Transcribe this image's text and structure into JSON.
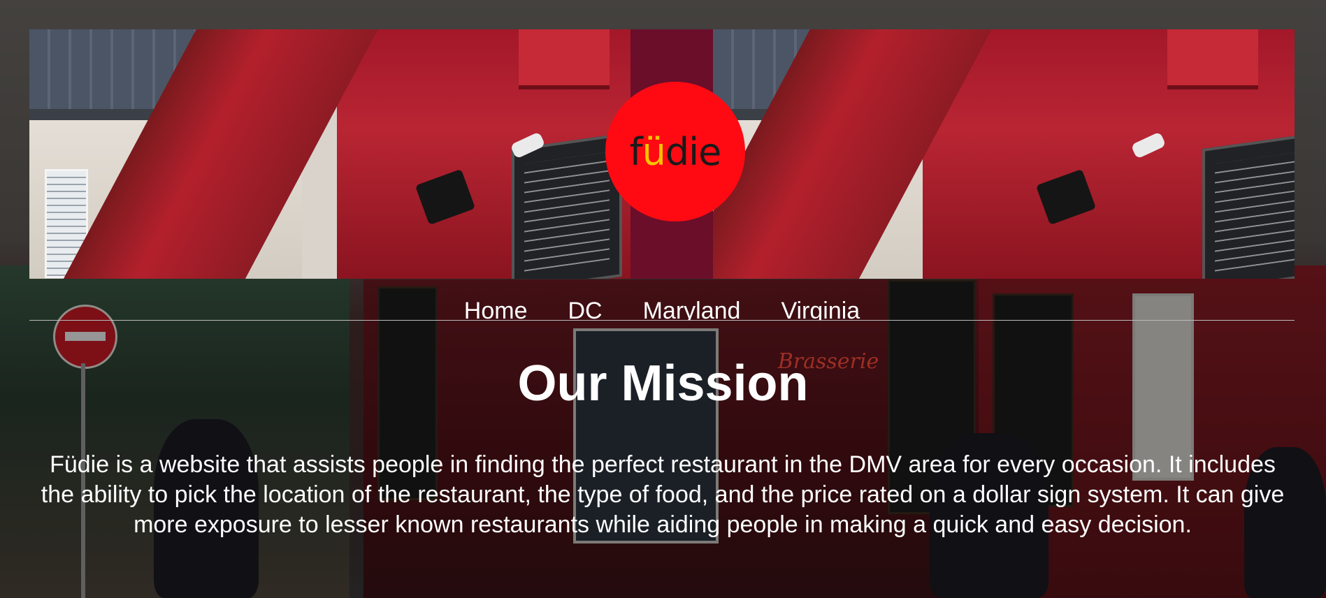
{
  "logo": {
    "prefix": "f",
    "accent": "ü",
    "suffix": "die"
  },
  "nav": {
    "items": [
      {
        "label": "Home"
      },
      {
        "label": "DC"
      },
      {
        "label": "Maryland"
      },
      {
        "label": "Virginia"
      }
    ]
  },
  "main": {
    "title": "Our Mission",
    "body": "Füdie is a website that assists people in finding the perfect restaurant in the DMV area for every occasion. It includes the ability to pick the location of the restaurant, the type of food, and the price rated on a dollar sign system. It can give more exposure to lesser known restaurants while aiding people in making a quick and easy decision."
  },
  "colors": {
    "logo_bg": "#ff0a12",
    "logo_accent": "#f5c400",
    "text": "#ffffff"
  }
}
